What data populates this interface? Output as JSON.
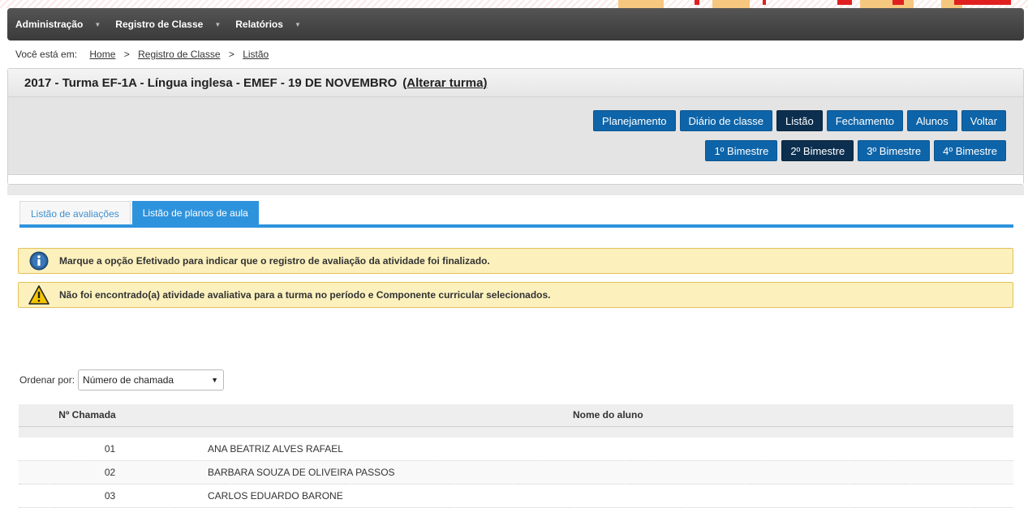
{
  "nav": {
    "items": [
      {
        "label": "Administração"
      },
      {
        "label": "Registro de Classe"
      },
      {
        "label": "Relatórios"
      }
    ]
  },
  "breadcrumb": {
    "prefix": "Você está em:",
    "links": [
      "Home",
      "Registro de Classe",
      "Listão"
    ],
    "separator": ">"
  },
  "panel": {
    "title": "2017 - Turma EF-1A - Língua inglesa - EMEF - 19 DE NOVEMBRO",
    "alter_link": "(Alterar turma)",
    "buttons": [
      "Planejamento",
      "Diário de classe",
      "Listão",
      "Fechamento",
      "Alunos",
      "Voltar"
    ],
    "active_button": "Listão",
    "bimesters": [
      "1º Bimestre",
      "2º Bimestre",
      "3º Bimestre",
      "4º Bimestre"
    ],
    "active_bimester": "2º Bimestre"
  },
  "tabs": [
    {
      "label": "Listão de avaliações",
      "active": false
    },
    {
      "label": "Listão de planos de aula",
      "active": true
    }
  ],
  "alerts": [
    {
      "type": "info",
      "icon": "info-icon",
      "text": "Marque a opção Efetivado para indicar que o registro de avaliação da atividade foi finalizado."
    },
    {
      "type": "warning",
      "icon": "warning-icon",
      "text": "Não foi encontrado(a) atividade avaliativa para a turma no período e Componente curricular selecionados."
    }
  ],
  "order_by": {
    "label": "Ordenar por:",
    "selected": "Número de chamada"
  },
  "table": {
    "headers": [
      "Nº Chamada",
      "Nome do aluno"
    ],
    "rows": [
      {
        "number": "01",
        "name": "ANA BEATRIZ ALVES RAFAEL"
      },
      {
        "number": "02",
        "name": "BARBARA SOUZA DE OLIVEIRA PASSOS"
      },
      {
        "number": "03",
        "name": "CARLOS EDUARDO BARONE"
      }
    ]
  },
  "colors": {
    "primary_button": "#0e64a8",
    "active_button": "#0c2f4f",
    "tab_active": "#2e93dd",
    "alert_bg": "#fcf1bd",
    "navbar": "#444444"
  }
}
